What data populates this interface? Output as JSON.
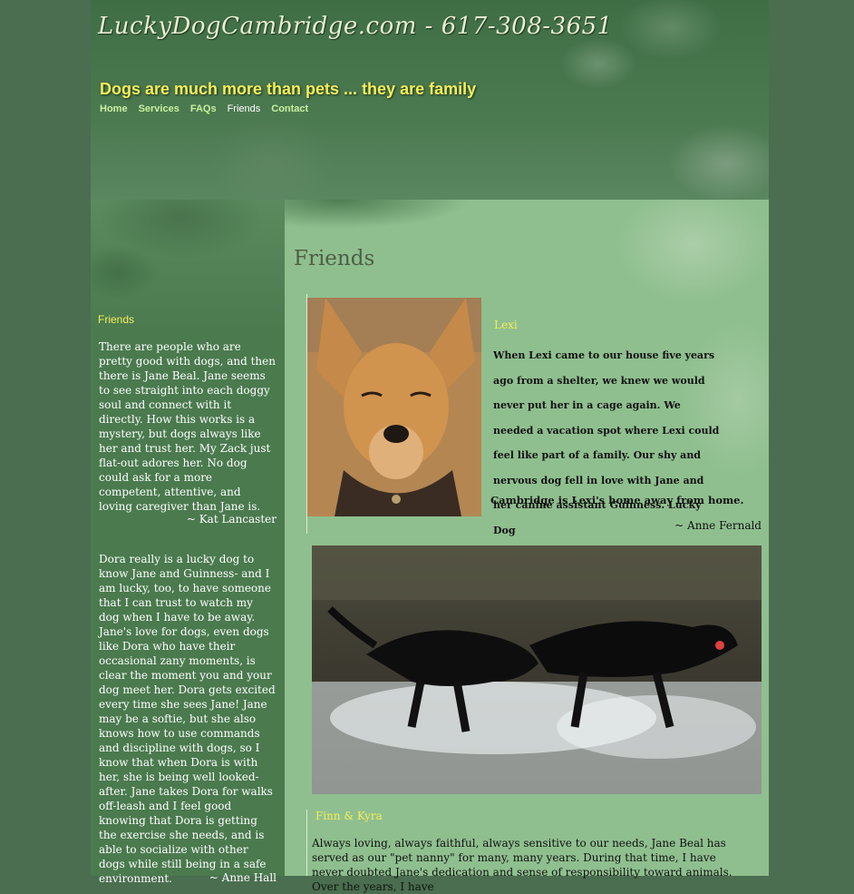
{
  "header": {
    "site_title": "LuckyDogCambridge.com - 617-308-3651",
    "tagline": "Dogs are much more than pets ... they are family"
  },
  "nav": {
    "items": [
      {
        "label": "Home"
      },
      {
        "label": "Services"
      },
      {
        "label": "FAQs"
      },
      {
        "label": "Friends"
      },
      {
        "label": "Contact"
      }
    ],
    "current": "Friends"
  },
  "sidebar": {
    "heading": "Friends",
    "testimonials": [
      {
        "text": "There are people who are pretty good with dogs, and then there is Jane Beal.  Jane seems to see straight into each doggy soul and connect with it directly. How this works is a mystery, but dogs always like her and trust her. My Zack just flat-out adores her. No dog could ask for a more competent, attentive, and  loving caregiver than Jane is.",
        "attribution": "~  Kat Lancaster"
      },
      {
        "text": "Dora really is a lucky dog to know Jane and Guinness- and I am lucky, too, to have someone that I can trust to watch my dog when I have to be away.  Jane's love for dogs, even dogs like Dora who have their occasional zany moments, is clear the moment you and your dog meet her.  Dora gets excited every time she sees Jane! Jane may be a softie, but she also knows how to use commands and discipline with dogs, so I know that when Dora is with her, she is being well looked-after.  Jane takes Dora for walks off-leash and I feel good knowing that Dora is getting the exercise she needs, and is able to socialize with other dogs while still being in a safe environment.",
        "attribution": "~  Anne Hall"
      }
    ]
  },
  "main": {
    "title": "Friends",
    "lexi": {
      "name": "Lexi",
      "text": "When Lexi came to our house five years ago from a  shelter, we knew we would never put her in a cage again.  We needed a vacation spot where Lexi could feel like part of a family.  Our shy and nervous dog fell in love with Jane and her canine assistant Guinness. Lucky Dog",
      "text_last": "Cambridge is Lexi's home away from home.",
      "attribution": "~  Anne Fernald"
    },
    "finn": {
      "name": "Finn & Kyra",
      "text": "Always loving, always faithful, always sensitive to our needs,  Jane Beal has served as our \"pet nanny\" for many, many years. During that time, I have never doubted Jane's dedication and sense of responsibility toward animals.  Over the years, I have"
    }
  },
  "colors": {
    "header_green": "#3f6e45",
    "tagline_yellow": "#f3ee5a",
    "nav_green": "#c8f0a0",
    "main_bg": "#8fbf8f",
    "sidebar_bg": "#4a7a4e"
  }
}
